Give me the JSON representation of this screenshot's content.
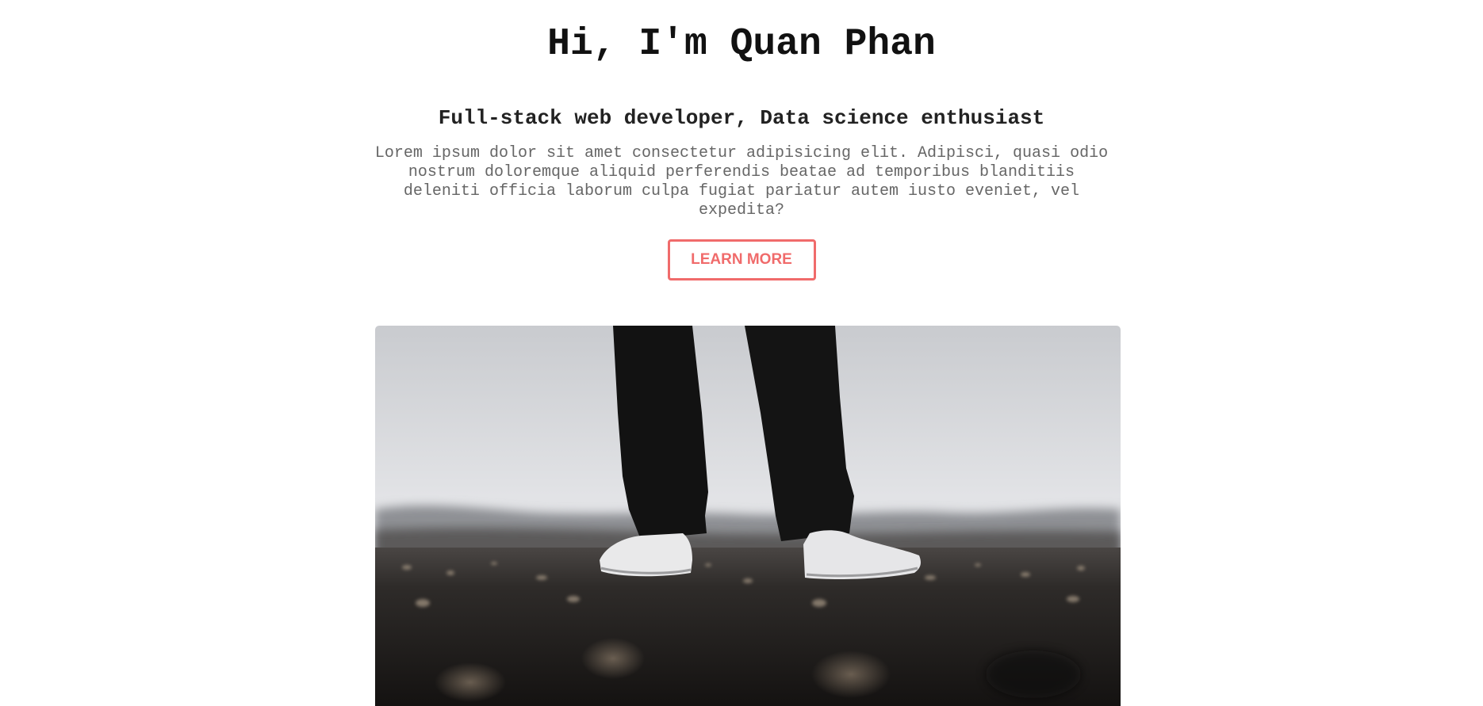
{
  "hero": {
    "title": "Hi, I'm Quan Phan",
    "subtitle": "Full-stack web developer, Data science enthusiast",
    "description": "Lorem ipsum dolor sit amet consectetur adipisicing elit. Adipisci, quasi odio nostrum doloremque aliquid perferendis beatae ad temporibus blanditiis deleniti officia laborum culpa fugiat pariatur autem iusto eveniet, vel expedita?",
    "button_label": "LEARN MORE"
  },
  "colors": {
    "accent": "#f06b6b",
    "title": "#111111",
    "body_text": "#666666"
  }
}
